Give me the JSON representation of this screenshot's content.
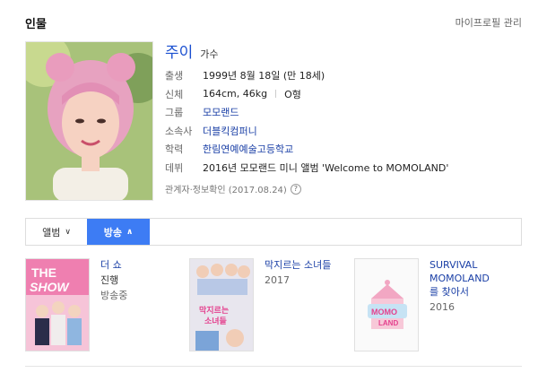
{
  "section": {
    "title": "인물",
    "top_link": "마이프로필 관리"
  },
  "person": {
    "name": "주이",
    "occupation": "가수",
    "rows": [
      {
        "label": "출생",
        "value": "1999년 8월 18일 (만 18세)",
        "link": false
      },
      {
        "label": "신체",
        "value": "164cm, 46kg",
        "extra": "O형",
        "link": false
      },
      {
        "label": "그룹",
        "value": "모모랜드",
        "link": true
      },
      {
        "label": "소속사",
        "value": "더블킥컴퍼니",
        "link": true
      },
      {
        "label": "학력",
        "value": "한림연예예술고등학교",
        "link": true
      },
      {
        "label": "데뷔",
        "value": "2016년 모모랜드 미니 앨범 'Welcome to MOMOLAND'",
        "link": false
      }
    ],
    "confirm": "관계자·정보확인 (2017.08.24)",
    "help_symbol": "?"
  },
  "tabs": {
    "album": {
      "label": "앨범",
      "chevron": "∨"
    },
    "broadcast": {
      "label": "방송",
      "chevron": "∧"
    }
  },
  "broadcasts": [
    {
      "title": "더 쇼",
      "line2": "진행",
      "line3": "방송중",
      "thumb_text": "THE SHOW"
    },
    {
      "title": "막지르는 소녀들",
      "line2": "2017",
      "line3": "",
      "thumb_text": "막지르는 소녀들"
    },
    {
      "title": "SURVIVAL MOMOLAND를 찾아서",
      "line2": "2016",
      "line3": "",
      "thumb_text": "MOMO LAND"
    }
  ],
  "colors": {
    "accent": "#3d7cf4",
    "link": "#1a3fa6",
    "name": "#1a4fd0"
  }
}
